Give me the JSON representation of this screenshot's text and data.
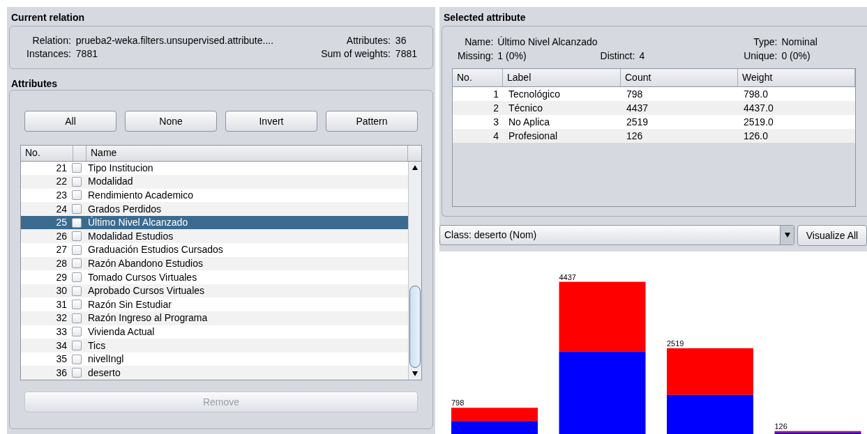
{
  "current_relation": {
    "title": "Current relation",
    "fields": [
      {
        "label": "Relation:",
        "value": "prueba2-weka.filters.unsupervised.attribute...."
      },
      {
        "label": "Attributes:",
        "value": "36"
      },
      {
        "label": "Instances:",
        "value": "7881"
      },
      {
        "label": "Sum of weights:",
        "value": "7881"
      }
    ]
  },
  "attributes": {
    "title": "Attributes",
    "buttons": [
      "All",
      "None",
      "Invert",
      "Pattern"
    ],
    "columns": [
      "No.",
      "Name"
    ],
    "rows": [
      {
        "no": "21",
        "name": "Tipo Institucion",
        "checked": false,
        "selected": false
      },
      {
        "no": "22",
        "name": "Modalidad",
        "checked": false,
        "selected": false
      },
      {
        "no": "23",
        "name": "Rendimiento Academico",
        "checked": false,
        "selected": false
      },
      {
        "no": "24",
        "name": "Grados Perdidos",
        "checked": false,
        "selected": false
      },
      {
        "no": "25",
        "name": "Último Nivel Alcanzado",
        "checked": false,
        "selected": true
      },
      {
        "no": "26",
        "name": "Modalidad Estudios",
        "checked": false,
        "selected": false
      },
      {
        "no": "27",
        "name": "Graduación Estudios Cursados",
        "checked": false,
        "selected": false
      },
      {
        "no": "28",
        "name": "Razón Abandono Estudios",
        "checked": false,
        "selected": false
      },
      {
        "no": "29",
        "name": "Tomado Cursos Virtuales",
        "checked": false,
        "selected": false
      },
      {
        "no": "30",
        "name": "Aprobado Cursos Virtuales",
        "checked": false,
        "selected": false
      },
      {
        "no": "31",
        "name": "Razón Sin Estudiar",
        "checked": false,
        "selected": false
      },
      {
        "no": "32",
        "name": "Razón Ingreso al Programa",
        "checked": false,
        "selected": false
      },
      {
        "no": "33",
        "name": "Vivienda Actual",
        "checked": false,
        "selected": false
      },
      {
        "no": "34",
        "name": "Tics",
        "checked": false,
        "selected": false
      },
      {
        "no": "35",
        "name": "nivelIngl",
        "checked": false,
        "selected": false
      },
      {
        "no": "36",
        "name": "deserto",
        "checked": false,
        "selected": false
      }
    ],
    "remove_button": {
      "label": "Remove",
      "disabled": true
    }
  },
  "selected_attribute": {
    "title": "Selected attribute",
    "fields": [
      {
        "label": "Name:",
        "value": "Último Nivel Alcanzado"
      },
      {
        "label": "Type:",
        "value": "Nominal"
      },
      {
        "label": "Missing:",
        "value": "1 (0%)"
      },
      {
        "label": "Distinct:",
        "value": "4"
      },
      {
        "label": "Unique:",
        "value": "0 (0%)"
      }
    ],
    "columns": [
      "No.",
      "Label",
      "Count",
      "Weight"
    ],
    "rows": [
      [
        "1",
        "Tecnológico",
        "798",
        "798.0"
      ],
      [
        "2",
        "Técnico",
        "4437",
        "4437.0"
      ],
      [
        "3",
        "No Aplica",
        "2519",
        "2519.0"
      ],
      [
        "4",
        "Profesional",
        "126",
        "126.0"
      ]
    ]
  },
  "class_selector": {
    "value": "Class: deserto (Nom)"
  },
  "visualize_button": "Visualize All",
  "histogram": {
    "bar_labels": [
      "798",
      "4437",
      "2519",
      "126"
    ]
  }
}
